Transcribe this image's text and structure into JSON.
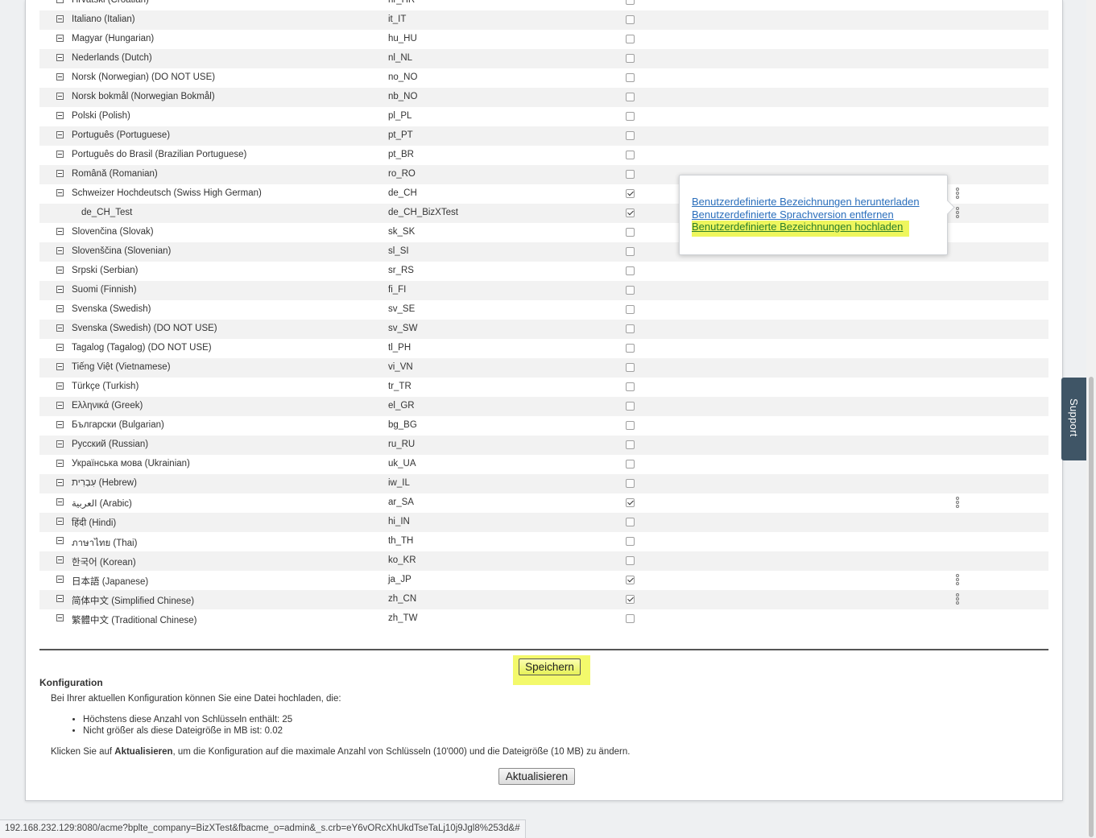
{
  "languages": [
    {
      "name": "Hrvatski (Croatian)",
      "code": "hr_HR",
      "checked": false,
      "more": false,
      "sub": false
    },
    {
      "name": "Italiano (Italian)",
      "code": "it_IT",
      "checked": false,
      "more": false,
      "sub": false
    },
    {
      "name": "Magyar (Hungarian)",
      "code": "hu_HU",
      "checked": false,
      "more": false,
      "sub": false
    },
    {
      "name": "Nederlands (Dutch)",
      "code": "nl_NL",
      "checked": false,
      "more": false,
      "sub": false
    },
    {
      "name": "Norsk (Norwegian) (DO NOT USE)",
      "code": "no_NO",
      "checked": false,
      "more": false,
      "sub": false
    },
    {
      "name": "Norsk bokmål (Norwegian Bokmål)",
      "code": "nb_NO",
      "checked": false,
      "more": false,
      "sub": false
    },
    {
      "name": "Polski (Polish)",
      "code": "pl_PL",
      "checked": false,
      "more": false,
      "sub": false
    },
    {
      "name": "Português (Portuguese)",
      "code": "pt_PT",
      "checked": false,
      "more": false,
      "sub": false
    },
    {
      "name": "Português do Brasil (Brazilian Portuguese)",
      "code": "pt_BR",
      "checked": false,
      "more": false,
      "sub": false
    },
    {
      "name": "Română (Romanian)",
      "code": "ro_RO",
      "checked": false,
      "more": false,
      "sub": false
    },
    {
      "name": "Schweizer Hochdeutsch (Swiss High German)",
      "code": "de_CH",
      "checked": true,
      "more": true,
      "sub": false
    },
    {
      "name": "de_CH_Test",
      "code": "de_CH_BizXTest",
      "checked": true,
      "more": true,
      "sub": true
    },
    {
      "name": "Slovenčina (Slovak)",
      "code": "sk_SK",
      "checked": false,
      "more": false,
      "sub": false
    },
    {
      "name": "Slovenščina (Slovenian)",
      "code": "sl_SI",
      "checked": false,
      "more": false,
      "sub": false
    },
    {
      "name": "Srpski (Serbian)",
      "code": "sr_RS",
      "checked": false,
      "more": false,
      "sub": false
    },
    {
      "name": "Suomi (Finnish)",
      "code": "fi_FI",
      "checked": false,
      "more": false,
      "sub": false
    },
    {
      "name": "Svenska (Swedish)",
      "code": "sv_SE",
      "checked": false,
      "more": false,
      "sub": false
    },
    {
      "name": "Svenska (Swedish) (DO NOT USE)",
      "code": "sv_SW",
      "checked": false,
      "more": false,
      "sub": false
    },
    {
      "name": "Tagalog (Tagalog) (DO NOT USE)",
      "code": "tl_PH",
      "checked": false,
      "more": false,
      "sub": false
    },
    {
      "name": "Tiếng Việt (Vietnamese)",
      "code": "vi_VN",
      "checked": false,
      "more": false,
      "sub": false
    },
    {
      "name": "Türkçe (Turkish)",
      "code": "tr_TR",
      "checked": false,
      "more": false,
      "sub": false
    },
    {
      "name": "Ελληνικά (Greek)",
      "code": "el_GR",
      "checked": false,
      "more": false,
      "sub": false
    },
    {
      "name": "Български (Bulgarian)",
      "code": "bg_BG",
      "checked": false,
      "more": false,
      "sub": false
    },
    {
      "name": "Русский (Russian)",
      "code": "ru_RU",
      "checked": false,
      "more": false,
      "sub": false
    },
    {
      "name": "Українська мова (Ukrainian)",
      "code": "uk_UA",
      "checked": false,
      "more": false,
      "sub": false
    },
    {
      "name": "עִבְרִית (Hebrew)",
      "code": "iw_IL",
      "checked": false,
      "more": false,
      "sub": false
    },
    {
      "name": "العربية (Arabic)",
      "code": "ar_SA",
      "checked": true,
      "more": true,
      "sub": false
    },
    {
      "name": "हिंदी (Hindi)",
      "code": "hi_IN",
      "checked": false,
      "more": false,
      "sub": false
    },
    {
      "name": "ภาษาไทย (Thai)",
      "code": "th_TH",
      "checked": false,
      "more": false,
      "sub": false
    },
    {
      "name": "한국어 (Korean)",
      "code": "ko_KR",
      "checked": false,
      "more": false,
      "sub": false
    },
    {
      "name": "日本語 (Japanese)",
      "code": "ja_JP",
      "checked": true,
      "more": true,
      "sub": false
    },
    {
      "name": "简体中文 (Simplified Chinese)",
      "code": "zh_CN",
      "checked": true,
      "more": true,
      "sub": false
    },
    {
      "name": "繁體中文 (Traditional Chinese)",
      "code": "zh_TW",
      "checked": false,
      "more": false,
      "sub": false
    }
  ],
  "popup": {
    "download_label": "Benutzerdefinierte Bezeichnungen herunterladen",
    "remove_label": "Benutzerdefinierte Sprachversion entfernen",
    "upload_label": "Benutzerdefinierte Bezeichnungen hochladen"
  },
  "save_label": "Speichern",
  "config": {
    "title": "Konfiguration",
    "intro": "Bei Ihrer aktuellen Konfiguration können Sie eine Datei hochladen, die:",
    "items": [
      "Höchstens diese Anzahl von Schlüsseln enthält: 25",
      "Nicht größer als diese Dateigröße in MB ist: 0.02"
    ],
    "note_prefix": "Klicken Sie auf ",
    "note_bold": "Aktualisieren",
    "note_suffix": ", um die Konfiguration auf die maximale Anzahl von Schlüsseln (10'000) und die Dateigröße (10 MB) zu ändern.",
    "update_label": "Aktualisieren"
  },
  "support_label": "Support",
  "status_url": "192.168.232.129:8080/acme?bplte_company=BizXTest&fbacme_o=admin&_s.crb=eY6vORcXhUkdTseTaLj10j9Jgl8%253d&#",
  "colors": {
    "highlight": "#f3f96b",
    "link": "#2a6ebb",
    "support_tab": "#3f5566"
  }
}
